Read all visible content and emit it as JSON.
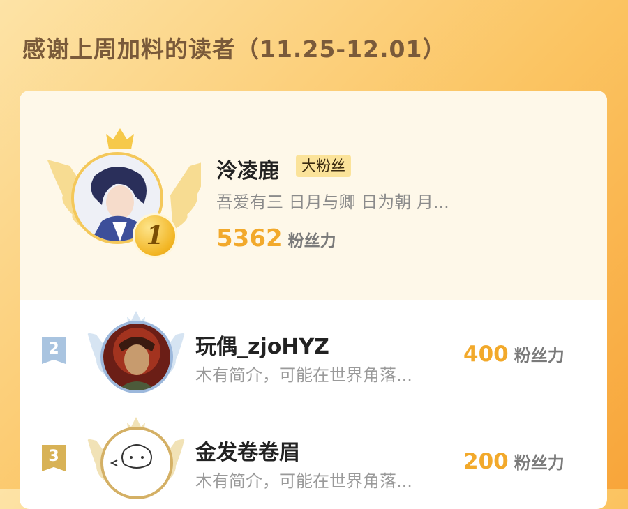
{
  "header": {
    "title": "感谢上周加料的读者（11.25-12.01）"
  },
  "top_reader": {
    "rank": "1",
    "name": "泠凌鹿",
    "tag": "大粉丝",
    "bio": "吾爱有三 日月与卿 日为朝 月...",
    "score": "5362",
    "score_unit": "粉丝力"
  },
  "readers": [
    {
      "rank": "2",
      "name": "玩偶_zjoHYZ",
      "bio": "木有简介，可能在世界角落...",
      "score": "400",
      "score_unit": "粉丝力"
    },
    {
      "rank": "3",
      "name": "金发卷卷眉",
      "bio": "木有简介，可能在世界角落...",
      "score": "200",
      "score_unit": "粉丝力"
    }
  ],
  "colors": {
    "accent_score": "#f2a92b",
    "rank1_gold": "#f2b523",
    "rank2_blue": "#a9c4e0",
    "rank3_gold": "#d8b256"
  }
}
